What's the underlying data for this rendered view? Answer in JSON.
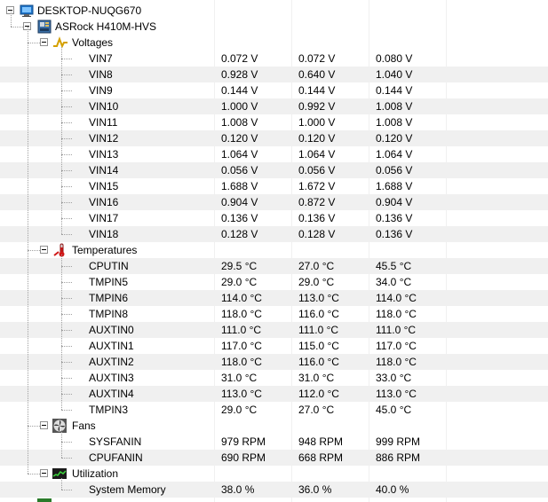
{
  "tree": {
    "computer": "DESKTOP-NUQG670",
    "board": "ASRock H410M-HVS",
    "groups": [
      {
        "name": "Voltages",
        "icon": "voltage-icon",
        "sensors": [
          {
            "name": "VIN7",
            "value": "0.072 V",
            "min": "0.072 V",
            "max": "0.080 V"
          },
          {
            "name": "VIN8",
            "value": "0.928 V",
            "min": "0.640 V",
            "max": "1.040 V"
          },
          {
            "name": "VIN9",
            "value": "0.144 V",
            "min": "0.144 V",
            "max": "0.144 V"
          },
          {
            "name": "VIN10",
            "value": "1.000 V",
            "min": "0.992 V",
            "max": "1.008 V"
          },
          {
            "name": "VIN11",
            "value": "1.008 V",
            "min": "1.000 V",
            "max": "1.008 V"
          },
          {
            "name": "VIN12",
            "value": "0.120 V",
            "min": "0.120 V",
            "max": "0.120 V"
          },
          {
            "name": "VIN13",
            "value": "1.064 V",
            "min": "1.064 V",
            "max": "1.064 V"
          },
          {
            "name": "VIN14",
            "value": "0.056 V",
            "min": "0.056 V",
            "max": "0.056 V"
          },
          {
            "name": "VIN15",
            "value": "1.688 V",
            "min": "1.672 V",
            "max": "1.688 V"
          },
          {
            "name": "VIN16",
            "value": "0.904 V",
            "min": "0.872 V",
            "max": "0.904 V"
          },
          {
            "name": "VIN17",
            "value": "0.136 V",
            "min": "0.136 V",
            "max": "0.136 V"
          },
          {
            "name": "VIN18",
            "value": "0.128 V",
            "min": "0.128 V",
            "max": "0.136 V"
          }
        ]
      },
      {
        "name": "Temperatures",
        "icon": "thermometer-icon",
        "sensors": [
          {
            "name": "CPUTIN",
            "value": "29.5 °C",
            "min": "27.0 °C",
            "max": "45.5 °C"
          },
          {
            "name": "TMPIN5",
            "value": "29.0 °C",
            "min": "29.0 °C",
            "max": "34.0 °C"
          },
          {
            "name": "TMPIN6",
            "value": "114.0 °C",
            "min": "113.0 °C",
            "max": "114.0 °C"
          },
          {
            "name": "TMPIN8",
            "value": "118.0 °C",
            "min": "116.0 °C",
            "max": "118.0 °C"
          },
          {
            "name": "AUXTIN0",
            "value": "111.0 °C",
            "min": "111.0 °C",
            "max": "111.0 °C"
          },
          {
            "name": "AUXTIN1",
            "value": "117.0 °C",
            "min": "115.0 °C",
            "max": "117.0 °C"
          },
          {
            "name": "AUXTIN2",
            "value": "118.0 °C",
            "min": "116.0 °C",
            "max": "118.0 °C"
          },
          {
            "name": "AUXTIN3",
            "value": "31.0 °C",
            "min": "31.0 °C",
            "max": "33.0 °C"
          },
          {
            "name": "AUXTIN4",
            "value": "113.0 °C",
            "min": "112.0 °C",
            "max": "113.0 °C"
          },
          {
            "name": "TMPIN3",
            "value": "29.0 °C",
            "min": "27.0 °C",
            "max": "45.0 °C"
          }
        ]
      },
      {
        "name": "Fans",
        "icon": "fan-icon",
        "sensors": [
          {
            "name": "SYSFANIN",
            "value": "979 RPM",
            "min": "948 RPM",
            "max": "999 RPM"
          },
          {
            "name": "CPUFANIN",
            "value": "690 RPM",
            "min": "668 RPM",
            "max": "886 RPM"
          }
        ]
      },
      {
        "name": "Utilization",
        "icon": "utilization-icon",
        "sensors": [
          {
            "name": "System Memory",
            "value": "38.0 %",
            "min": "36.0 %",
            "max": "40.0 %"
          }
        ]
      }
    ]
  }
}
